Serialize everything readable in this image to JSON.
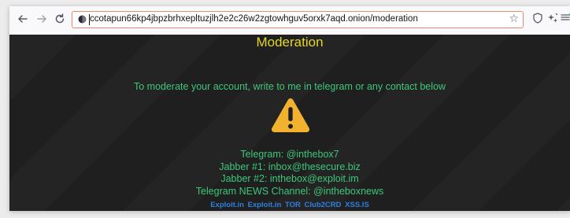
{
  "browser": {
    "url": "ccotapun66kp4jbpzbrhxepltuzjlh2e2c26w2zgtowhguv5orxk7aqd.onion/moderation",
    "back_icon": "arrow-left-icon",
    "forward_icon": "arrow-right-icon",
    "reload_icon": "reload-icon",
    "bookmark_icon": "star-icon",
    "shield_icon": "shield-icon",
    "extensions_icon": "sparkle-icon",
    "menu_icon": "hamburger-menu-icon"
  },
  "page": {
    "title": "Moderation",
    "intro": "To moderate your account, write to me in telegram or any contact below",
    "warning_icon": "warning-triangle-icon",
    "contacts": [
      "Telegram: @inthebox7",
      "Jabber #1: inbox@thesecure.biz",
      "Jabber #2: inthebox@exploit.im",
      "Telegram NEWS Channel: @intheboxnews"
    ],
    "links": [
      "Exploit.in",
      "Exploit.in",
      "TOR",
      "Club2CRD",
      "XSS.IS"
    ]
  },
  "colors": {
    "title": "#e6d62a",
    "text": "#3ec77a",
    "links": "#2f7fe0",
    "warning": "#f2b230",
    "background": "#1f1f1f",
    "url_focus_border": "#e88a6e"
  }
}
